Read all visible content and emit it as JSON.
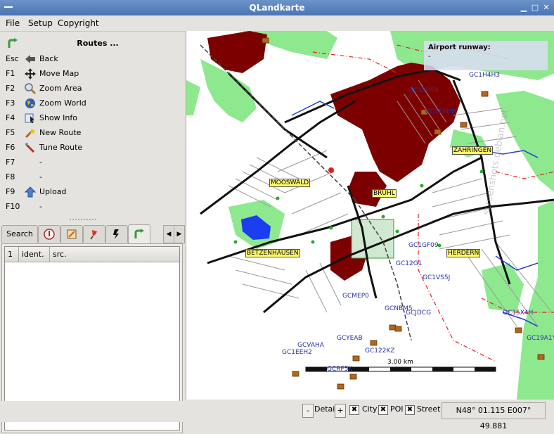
{
  "window": {
    "title": "QLandkarte"
  },
  "menu": {
    "items": [
      "File",
      "Setup",
      "Copyright"
    ]
  },
  "panel": {
    "title": "Routes ..."
  },
  "fkeys": [
    {
      "key": "Esc",
      "label": "Back",
      "icon": "back-arrow-icon"
    },
    {
      "key": "F1",
      "label": "Move Map",
      "icon": "move-icon"
    },
    {
      "key": "F2",
      "label": "Zoom Area",
      "icon": "zoom-area-icon"
    },
    {
      "key": "F3",
      "label": "Zoom World",
      "icon": "globe-icon"
    },
    {
      "key": "F4",
      "label": "Show Info",
      "icon": "info-icon"
    },
    {
      "key": "F5",
      "label": "New Route",
      "icon": "new-route-icon"
    },
    {
      "key": "F6",
      "label": "Tune Route",
      "icon": "tune-route-icon"
    },
    {
      "key": "F7",
      "label": "-",
      "icon": ""
    },
    {
      "key": "F8",
      "label": "-",
      "icon": ""
    },
    {
      "key": "F9",
      "label": "Upload",
      "icon": "upload-icon"
    },
    {
      "key": "F10",
      "label": "-",
      "icon": ""
    }
  ],
  "tabs": {
    "search_label": "Search"
  },
  "table": {
    "columns": [
      "1",
      "ident.",
      "src."
    ]
  },
  "map": {
    "info_title": "Airport runway:",
    "info_value": "-",
    "labels": [
      "MOOSWALD",
      "BRUHL",
      "ZAHRINGEN",
      "BETZENHAUSEN",
      "HERDERN"
    ],
    "geocaches": [
      "GC1EH50",
      "GC1E6HH",
      "GC1H4H3",
      "GC1GF09",
      "GC12G1",
      "GC1VS5J",
      "GCMEP0",
      "GCNBM5",
      "GCJDCG",
      "GCYEAB",
      "GC122KZ",
      "GCVAHA",
      "GC1EEH2",
      "GCRF5K",
      "GC15X4H",
      "GC19A1Y"
    ],
    "scale": "3.00 km",
    "watermark": "screenshots.debian.net"
  },
  "status": {
    "minus": "-",
    "detail": "Detail",
    "plus": "+",
    "city": "City",
    "poi": "POI",
    "street": "Street",
    "check_mark": "✖",
    "coords": "N48° 01.115 E007° 49.881"
  }
}
